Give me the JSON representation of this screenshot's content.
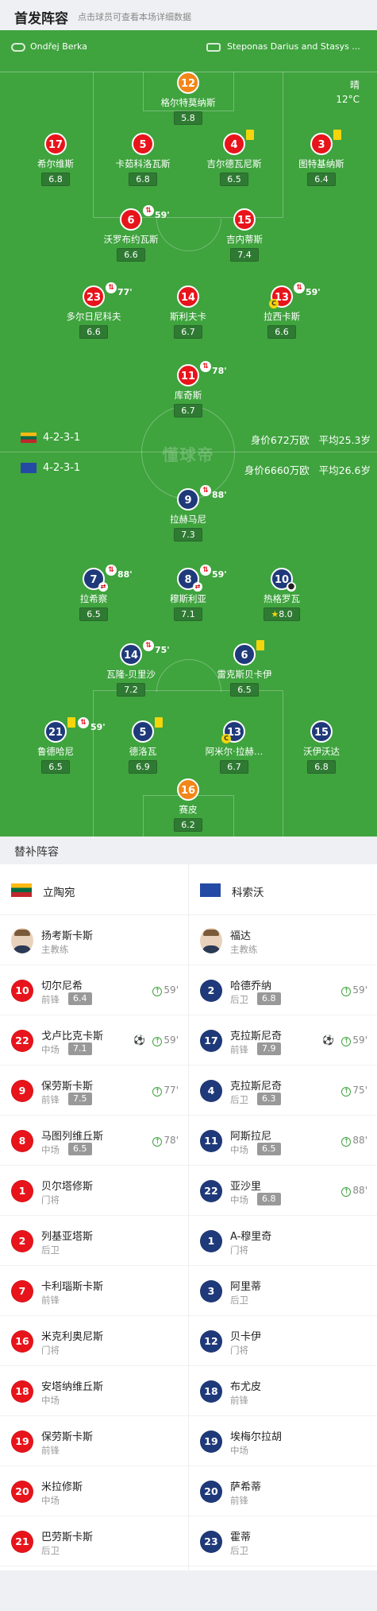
{
  "header": {
    "title": "首发阵容",
    "hint": "点击球员可查看本场详细数据"
  },
  "pitch": {
    "home_team": "Ondřej Berka",
    "away_team": "Steponas Darius and Stasys ...",
    "weather": "晴",
    "temperature": "12°C",
    "watermark": "懂球帝",
    "home_formation": "4-2-3-1",
    "away_formation": "4-2-3-1",
    "home_value": "身价672万欧",
    "home_avg_age": "平均25.3岁",
    "away_value": "身价6660万欧",
    "away_avg_age": "平均26.6岁",
    "players": [
      {
        "num": "12",
        "name": "格尔特莫纳斯",
        "rating": "5.8",
        "color": "orange"
      },
      {
        "num": "17",
        "name": "希尔维斯",
        "rating": "6.8",
        "color": "red"
      },
      {
        "num": "5",
        "name": "卡茹科洛瓦斯",
        "rating": "6.8",
        "color": "red"
      },
      {
        "num": "4",
        "name": "吉尔德瓦尼斯",
        "rating": "6.5",
        "color": "red",
        "yellow": true
      },
      {
        "num": "3",
        "name": "图特基纳斯",
        "rating": "6.4",
        "color": "red",
        "yellow": true
      },
      {
        "num": "6",
        "name": "沃罗布约瓦斯",
        "rating": "6.6",
        "color": "red",
        "sub": "59'"
      },
      {
        "num": "15",
        "name": "吉内蒂斯",
        "rating": "7.4",
        "color": "red"
      },
      {
        "num": "23",
        "name": "多尔日尼科夫",
        "rating": "6.6",
        "color": "red",
        "sub": "77'"
      },
      {
        "num": "14",
        "name": "斯利夫卡",
        "rating": "6.7",
        "color": "red"
      },
      {
        "num": "13",
        "name": "拉西卡斯",
        "rating": "6.6",
        "color": "red",
        "sub": "59'",
        "captain": "C"
      },
      {
        "num": "11",
        "name": "库奇斯",
        "rating": "6.7",
        "color": "red",
        "sub": "78'"
      },
      {
        "num": "9",
        "name": "拉赫马尼",
        "rating": "7.3",
        "color": "navy",
        "sub": "88'"
      },
      {
        "num": "7",
        "name": "拉希察",
        "rating": "6.5",
        "color": "navy",
        "sub": "88'"
      },
      {
        "num": "8",
        "name": "穆斯利亚",
        "rating": "7.1",
        "color": "navy",
        "sub": "59'"
      },
      {
        "num": "10",
        "name": "热格罗瓦",
        "rating": "8.0",
        "color": "navy",
        "goal": true,
        "star": true
      },
      {
        "num": "14",
        "name": "瓦隆-贝里沙",
        "rating": "7.2",
        "color": "navy",
        "sub": "75'"
      },
      {
        "num": "6",
        "name": "雷克斯贝卡伊",
        "rating": "6.5",
        "color": "navy",
        "yellow": true
      },
      {
        "num": "21",
        "name": "鲁德哈尼",
        "rating": "6.5",
        "color": "navy",
        "yellow": true,
        "sub": "59'"
      },
      {
        "num": "5",
        "name": "德洛瓦",
        "rating": "6.9",
        "color": "navy",
        "yellow": true
      },
      {
        "num": "13",
        "name": "阿米尔·拉赫…",
        "rating": "6.7",
        "color": "navy",
        "captain": "C"
      },
      {
        "num": "15",
        "name": "沃伊沃达",
        "rating": "6.8",
        "color": "navy"
      },
      {
        "num": "16",
        "name": "赛皮",
        "rating": "6.2",
        "color": "orange"
      }
    ]
  },
  "subs_title": "替补阵容",
  "home": {
    "team": "立陶宛",
    "coach": {
      "name": "扬考斯卡斯",
      "role": "主教练"
    },
    "subs": [
      {
        "num": "10",
        "name": "切尔尼希",
        "pos": "前锋",
        "rating": "6.4",
        "sub": "59'"
      },
      {
        "num": "22",
        "name": "戈卢比克卡斯",
        "pos": "中场",
        "rating": "7.1",
        "sub": "59'",
        "goal": true
      },
      {
        "num": "9",
        "name": "保劳斯卡斯",
        "pos": "前锋",
        "rating": "7.5",
        "sub": "77'"
      },
      {
        "num": "8",
        "name": "马图列维丘斯",
        "pos": "中场",
        "rating": "6.5",
        "sub": "78'"
      },
      {
        "num": "1",
        "name": "贝尔塔修斯",
        "pos": "门将"
      },
      {
        "num": "2",
        "name": "列基亚塔斯",
        "pos": "后卫"
      },
      {
        "num": "7",
        "name": "卡利瑙斯卡斯",
        "pos": "前锋"
      },
      {
        "num": "16",
        "name": "米克利奥尼斯",
        "pos": "门将"
      },
      {
        "num": "18",
        "name": "安塔纳维丘斯",
        "pos": "中场"
      },
      {
        "num": "19",
        "name": "保劳斯卡斯",
        "pos": "前锋"
      },
      {
        "num": "20",
        "name": "米拉修斯",
        "pos": "中场"
      },
      {
        "num": "21",
        "name": "巴劳斯卡斯",
        "pos": "后卫"
      }
    ]
  },
  "away": {
    "team": "科索沃",
    "coach": {
      "name": "福达",
      "role": "主教练"
    },
    "subs": [
      {
        "num": "2",
        "name": "哈德乔纳",
        "pos": "后卫",
        "rating": "6.8",
        "sub": "59'"
      },
      {
        "num": "17",
        "name": "克拉斯尼奇",
        "pos": "前锋",
        "rating": "7.9",
        "sub": "59'",
        "goal": true
      },
      {
        "num": "4",
        "name": "克拉斯尼奇",
        "pos": "后卫",
        "rating": "6.3",
        "sub": "75'"
      },
      {
        "num": "11",
        "name": "阿斯拉尼",
        "pos": "中场",
        "rating": "6.5",
        "sub": "88'"
      },
      {
        "num": "22",
        "name": "亚沙里",
        "pos": "中场",
        "rating": "6.8",
        "sub": "88'"
      },
      {
        "num": "1",
        "name": "A-穆里奇",
        "pos": "门将"
      },
      {
        "num": "3",
        "name": "阿里蒂",
        "pos": "后卫"
      },
      {
        "num": "12",
        "name": "贝卡伊",
        "pos": "门将"
      },
      {
        "num": "18",
        "name": "布尤皮",
        "pos": "前锋"
      },
      {
        "num": "19",
        "name": "埃梅尔拉胡",
        "pos": "中场"
      },
      {
        "num": "20",
        "name": "萨希蒂",
        "pos": "前锋"
      },
      {
        "num": "23",
        "name": "霍蒂",
        "pos": "后卫"
      }
    ]
  }
}
